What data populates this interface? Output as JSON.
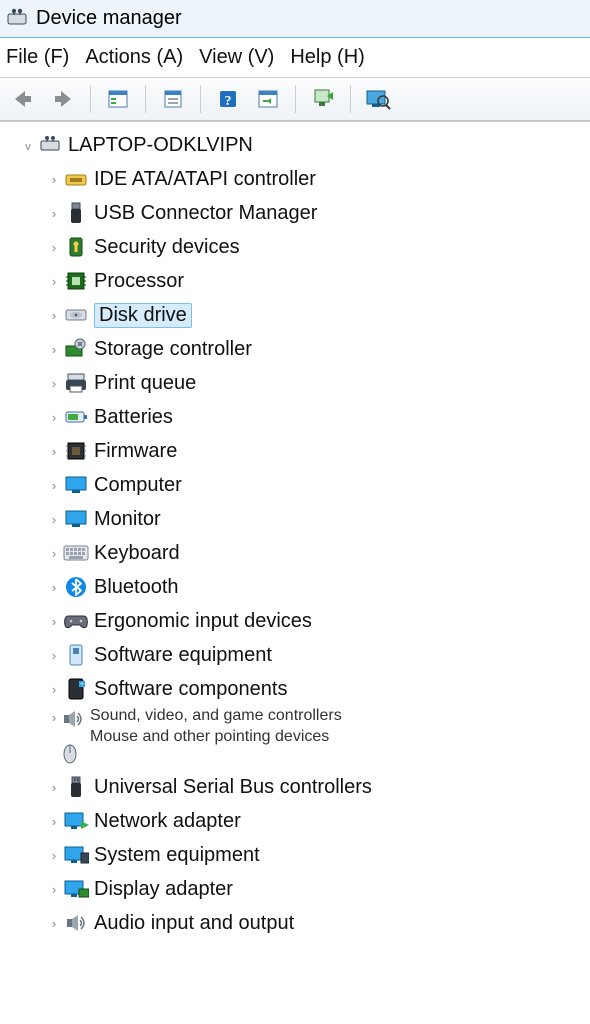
{
  "window": {
    "title": "Device manager"
  },
  "menu": {
    "file": "File (F)",
    "actions": "Actions (A)",
    "view": "View (V)",
    "help": "Help (H)"
  },
  "tree": {
    "root": "LAPTOP-ODKLVIPN",
    "categories": [
      {
        "label": "IDE ATA/ATAPI controller",
        "icon": "ide-controller-icon",
        "selected": false
      },
      {
        "label": "USB Connector Manager",
        "icon": "usb-plug-icon",
        "selected": false
      },
      {
        "label": "Security devices",
        "icon": "security-device-icon",
        "selected": false
      },
      {
        "label": "Processor",
        "icon": "processor-icon",
        "selected": false
      },
      {
        "label": "Disk drive",
        "icon": "disk-drive-icon",
        "selected": true
      },
      {
        "label": "Storage controller",
        "icon": "storage-controller-icon",
        "selected": false
      },
      {
        "label": "Print queue",
        "icon": "printer-icon",
        "selected": false
      },
      {
        "label": "Batteries",
        "icon": "battery-icon",
        "selected": false
      },
      {
        "label": "Firmware",
        "icon": "firmware-chip-icon",
        "selected": false
      },
      {
        "label": "Computer",
        "icon": "monitor-blue-icon",
        "selected": false
      },
      {
        "label": "Monitor",
        "icon": "monitor-blue-icon",
        "selected": false
      },
      {
        "label": "Keyboard",
        "icon": "keyboard-icon",
        "selected": false
      },
      {
        "label": "Bluetooth",
        "icon": "bluetooth-icon",
        "selected": false
      },
      {
        "label": "Ergonomic input devices",
        "icon": "game-controller-icon",
        "selected": false
      },
      {
        "label": "Software equipment",
        "icon": "software-equipment-icon",
        "selected": false
      },
      {
        "label": "Software components",
        "icon": "software-component-icon",
        "selected": false
      },
      {
        "label": "Sound, video, and game controllers Mouse and other pointing devices",
        "icon": "speaker-icon+mouse-icon",
        "selected": false,
        "multiline": true
      },
      {
        "label": "Universal Serial Bus controllers",
        "icon": "usb-hub-icon",
        "selected": false
      },
      {
        "label": "Network adapter",
        "icon": "network-adapter-icon",
        "selected": false
      },
      {
        "label": "System equipment",
        "icon": "system-equipment-icon",
        "selected": false
      },
      {
        "label": "Display adapter",
        "icon": "display-adapter-icon",
        "selected": false
      },
      {
        "label": "Audio input and output",
        "icon": "speaker-icon",
        "selected": false
      }
    ]
  }
}
